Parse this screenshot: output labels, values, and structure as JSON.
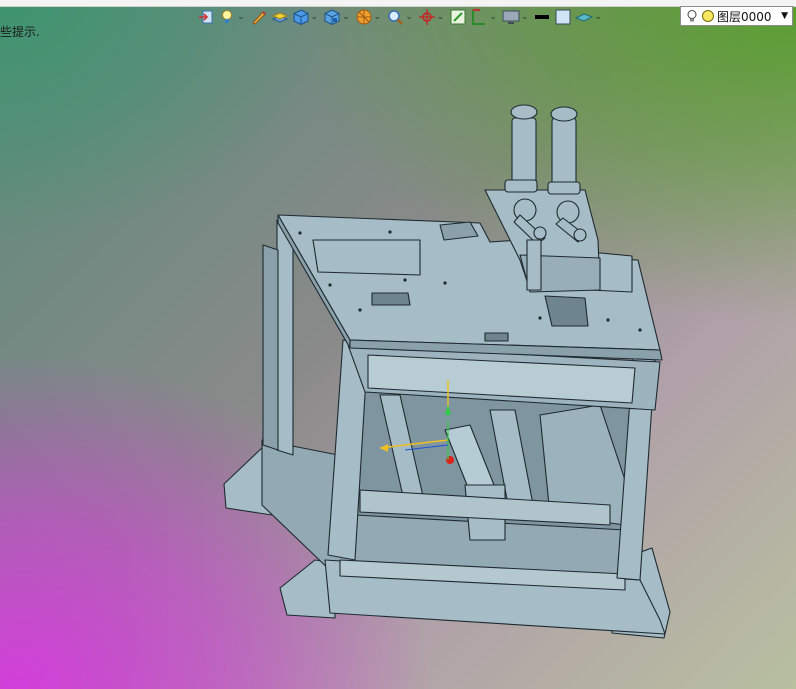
{
  "hint_text": "些提示.",
  "toolbar": {
    "items": [
      {
        "icon": "exit-view-icon"
      },
      {
        "icon": "light-bulb-icon",
        "dropdown": true
      },
      {
        "icon": "pen-icon"
      },
      {
        "icon": "layer-stack-icon"
      },
      {
        "icon": "cube-icon",
        "dropdown": true
      },
      {
        "icon": "view-cube-icon",
        "dropdown": true
      },
      {
        "icon": "sphere-icon",
        "dropdown": true
      },
      {
        "icon": "zoom-icon",
        "dropdown": true
      },
      {
        "icon": "origin-axis-icon",
        "dropdown": true
      },
      {
        "icon": "grid-icon"
      },
      {
        "icon": "ruler-icon",
        "dropdown": true
      },
      {
        "icon": "monitor-icon",
        "dropdown": true
      },
      {
        "icon": "line-weight-icon"
      },
      {
        "icon": "color-swatch-icon"
      },
      {
        "icon": "plane-icon",
        "dropdown": true
      }
    ],
    "dropdown_glyph": "⌄"
  },
  "layer_select": {
    "value": "图层0000",
    "arrow": "▼",
    "color": "#f5e860"
  },
  "colors": {
    "model_fill": "#a6bcc6",
    "model_stroke": "#1e2a30",
    "accent_green": "#2ecc40",
    "accent_red": "#e0201a",
    "accent_yellow": "#f0c020"
  }
}
